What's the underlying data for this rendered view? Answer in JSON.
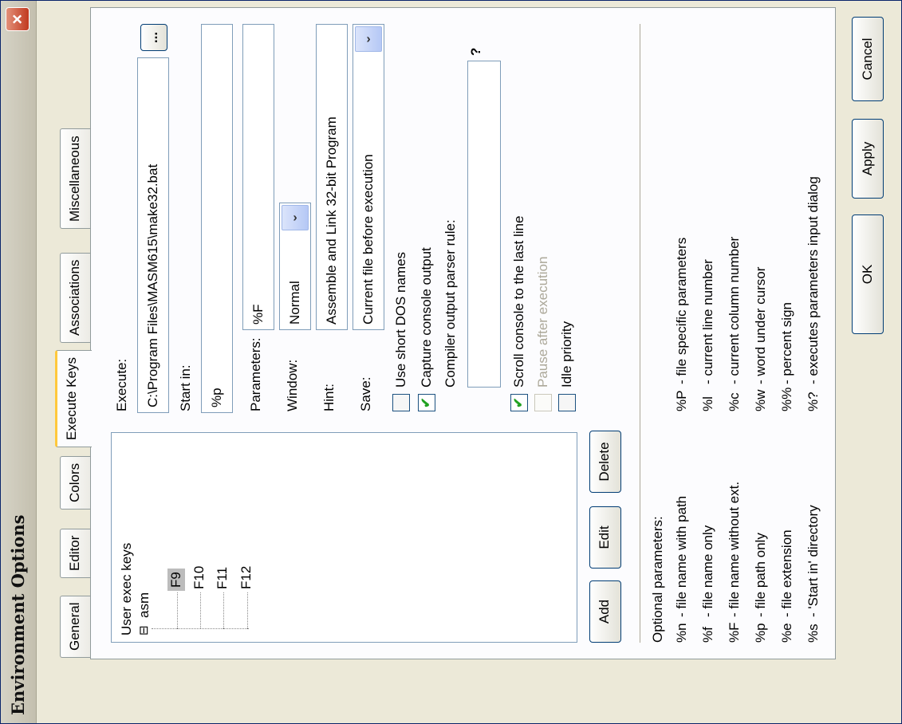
{
  "window": {
    "title": "Environment Options",
    "close_glyph": "×"
  },
  "tabs": [
    "General",
    "Editor",
    "Colors",
    "Execute Keys",
    "Associations",
    "Miscellaneous"
  ],
  "active_tab": "Execute Keys",
  "tree": {
    "root": "User exec keys",
    "expander": "⊟",
    "group": "asm",
    "items": [
      "F9",
      "F10",
      "F11",
      "F12"
    ],
    "selected": "F9"
  },
  "tree_buttons": {
    "add": "Add",
    "edit": "Edit",
    "delete": "Delete"
  },
  "form": {
    "execute_label": "Execute:",
    "execute_value": "C:\\Program Files\\MASM615\\make32.bat",
    "browse_label": "...",
    "start_in_label": "Start in:",
    "start_in_value": "%p",
    "parameters_label": "Parameters:",
    "parameters_value": "%F",
    "window_label": "Window:",
    "window_value": "Normal",
    "hint_label": "Hint:",
    "hint_value": "Assemble and Link 32-bit Program",
    "save_label": "Save:",
    "save_value": "Current file before execution",
    "dropdown_glyph": "›"
  },
  "checkboxes": [
    {
      "label": "Use short DOS names",
      "checked": false,
      "disabled": false
    },
    {
      "label": "Capture console output",
      "checked": true,
      "disabled": false
    },
    {
      "label": "Scroll console to the last line",
      "checked": true,
      "disabled": false
    },
    {
      "label": "Pause after execution",
      "checked": false,
      "disabled": true
    },
    {
      "label": "Idle priority",
      "checked": false,
      "disabled": false
    }
  ],
  "parser_rule": {
    "label": "Compiler output parser rule:",
    "help": "?",
    "value": ""
  },
  "optional_params": {
    "header": "Optional parameters:",
    "left": [
      {
        "code": "%n",
        "desc": "- file name with path"
      },
      {
        "code": "%f",
        "desc": "- file name only"
      },
      {
        "code": "%F",
        "desc": "- file name without ext."
      },
      {
        "code": "%p",
        "desc": "- file path only"
      },
      {
        "code": "%e",
        "desc": "- file extension"
      },
      {
        "code": "%s",
        "desc": "- 'Start in' directory"
      }
    ],
    "right": [
      {
        "code": "%P",
        "desc": "- file specific parameters"
      },
      {
        "code": "%l",
        "desc": "- current line number"
      },
      {
        "code": "%c",
        "desc": "- current column number"
      },
      {
        "code": "%w",
        "desc": "- word under cursor"
      },
      {
        "code": "%%",
        "desc": "- percent sign"
      },
      {
        "code": "%?",
        "desc": "- executes parameters input dialog"
      }
    ]
  },
  "dialog_buttons": {
    "ok": "OK",
    "apply": "Apply",
    "cancel": "Cancel"
  },
  "colors": {
    "tab_highlight": "#ffc83c",
    "check": "#21a121",
    "title_bar": "#c3bfae",
    "close": "#c1391e"
  }
}
